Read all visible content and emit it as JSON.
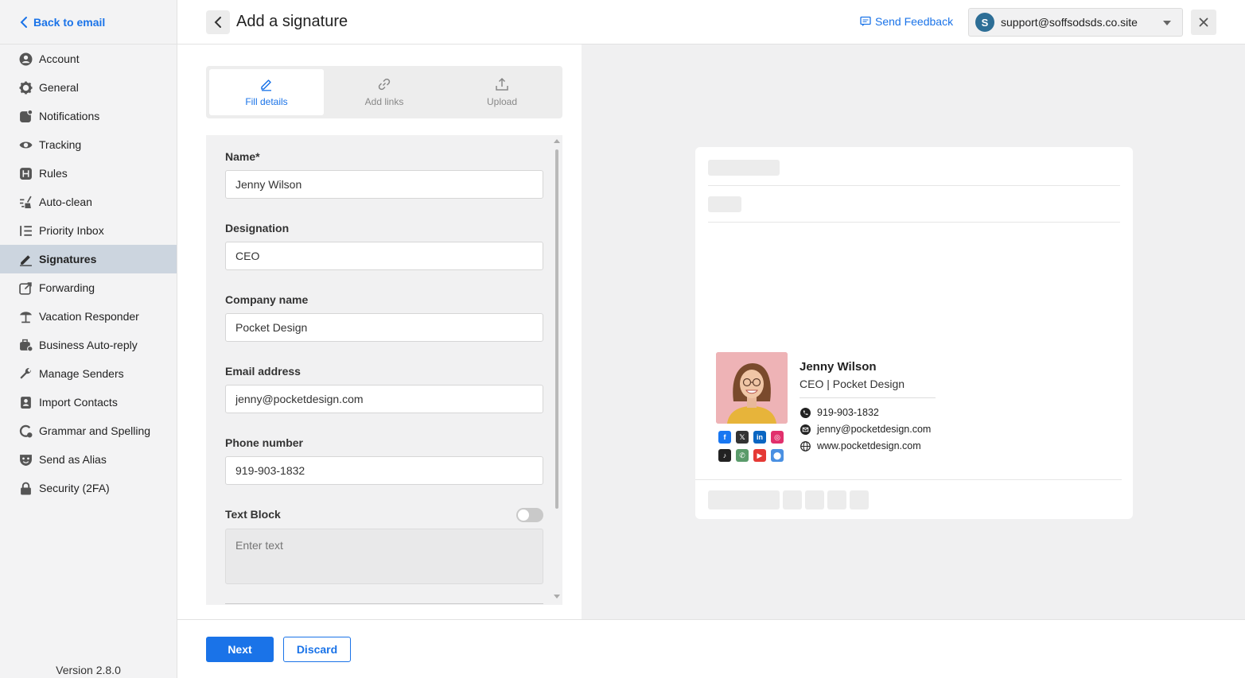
{
  "sidebar": {
    "back_label": "Back to email",
    "items": [
      {
        "label": "Account",
        "icon": "account-icon"
      },
      {
        "label": "General",
        "icon": "gear-icon"
      },
      {
        "label": "Notifications",
        "icon": "bell-icon"
      },
      {
        "label": "Tracking",
        "icon": "eye-icon"
      },
      {
        "label": "Rules",
        "icon": "rules-icon"
      },
      {
        "label": "Auto-clean",
        "icon": "broom-icon"
      },
      {
        "label": "Priority Inbox",
        "icon": "priority-list-icon"
      },
      {
        "label": "Signatures",
        "icon": "pen-icon",
        "active": true
      },
      {
        "label": "Forwarding",
        "icon": "forward-icon"
      },
      {
        "label": "Vacation Responder",
        "icon": "umbrella-icon"
      },
      {
        "label": "Business Auto-reply",
        "icon": "briefcase-icon"
      },
      {
        "label": "Manage Senders",
        "icon": "wrench-icon"
      },
      {
        "label": "Import Contacts",
        "icon": "contacts-icon"
      },
      {
        "label": "Grammar and Spelling",
        "icon": "grammar-icon"
      },
      {
        "label": "Send as Alias",
        "icon": "mask-icon"
      },
      {
        "label": "Security (2FA)",
        "icon": "lock-icon"
      }
    ],
    "version": "Version 2.8.0"
  },
  "header": {
    "title": "Add a signature",
    "feedback_label": "Send Feedback",
    "account_initial": "S",
    "account_email": "support@soffsodsds.co.site"
  },
  "tabs": [
    {
      "label": "Fill details",
      "icon": "pencil-icon",
      "active": true
    },
    {
      "label": "Add links",
      "icon": "link-icon"
    },
    {
      "label": "Upload",
      "icon": "upload-icon"
    }
  ],
  "form": {
    "name_label": "Name*",
    "name_value": "Jenny Wilson",
    "designation_label": "Designation",
    "designation_value": "CEO",
    "company_label": "Company name",
    "company_value": "Pocket Design",
    "email_label": "Email address",
    "email_value": "jenny@pocketdesign.com",
    "phone_label": "Phone number",
    "phone_value": "919-903-1832",
    "textblock_label": "Text Block",
    "textblock_placeholder": "Enter text",
    "textblock_enabled": false
  },
  "signature_preview": {
    "name": "Jenny Wilson",
    "title_line": "CEO | Pocket Design",
    "phone": "919-903-1832",
    "email": "jenny@pocketdesign.com",
    "website": "www.pocketdesign.com",
    "social": [
      {
        "icon": "facebook-icon",
        "glyph": "f",
        "color": "#1877f2"
      },
      {
        "icon": "x-icon",
        "glyph": "𝕏",
        "color": "#333333"
      },
      {
        "icon": "linkedin-icon",
        "glyph": "in",
        "color": "#0a66c2"
      },
      {
        "icon": "instagram-icon",
        "glyph": "◎",
        "color": "#e1306c"
      },
      {
        "icon": "tiktok-icon",
        "glyph": "♪",
        "color": "#222222"
      },
      {
        "icon": "whatsapp-icon",
        "glyph": "✆",
        "color": "#5a9b6b"
      },
      {
        "icon": "youtube-icon",
        "glyph": "▶",
        "color": "#e53935"
      },
      {
        "icon": "location-icon",
        "glyph": "⬤",
        "color": "#4a90e2"
      }
    ]
  },
  "footer": {
    "next_label": "Next",
    "discard_label": "Discard"
  },
  "colors": {
    "accent": "#1a73e8",
    "sidebar_active": "#ccd5df",
    "avatar": "#2d6e96"
  }
}
